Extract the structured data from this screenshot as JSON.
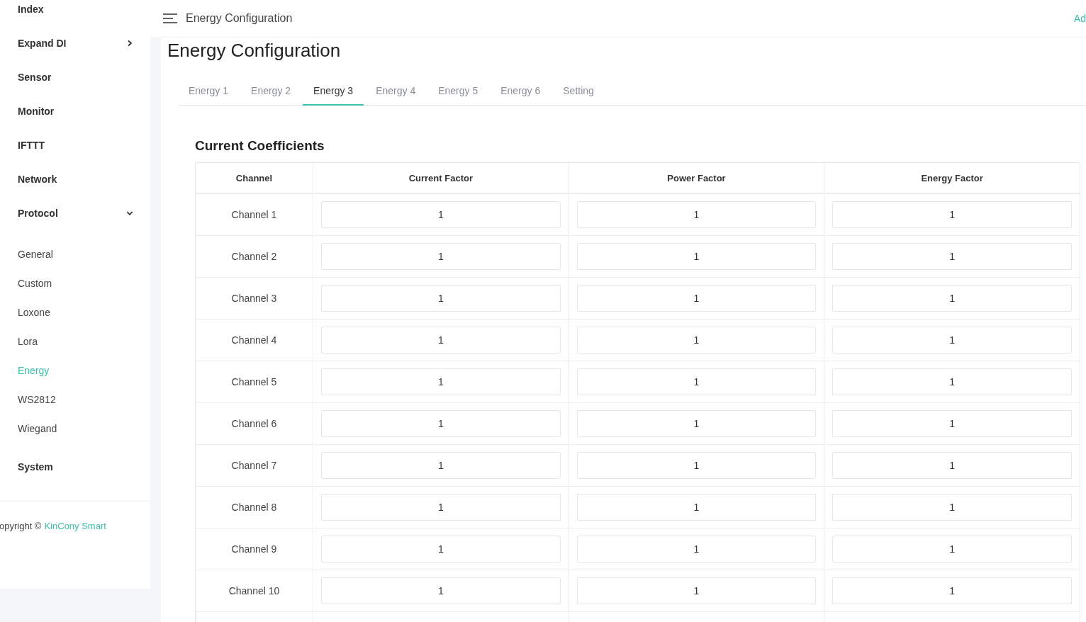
{
  "sidebar": {
    "items": [
      {
        "label": "Index",
        "kind": "group"
      },
      {
        "label": "Expand DI",
        "kind": "group",
        "expanded": false
      },
      {
        "label": "Sensor",
        "kind": "group"
      },
      {
        "label": "Monitor",
        "kind": "group"
      },
      {
        "label": "IFTTT",
        "kind": "group"
      },
      {
        "label": "Network",
        "kind": "group"
      },
      {
        "label": "Protocol",
        "kind": "group",
        "expanded": true,
        "children": [
          {
            "label": "General",
            "selected": false
          },
          {
            "label": "Custom",
            "selected": false
          },
          {
            "label": "Loxone",
            "selected": false
          },
          {
            "label": "Lora",
            "selected": false
          },
          {
            "label": "Energy",
            "selected": true
          },
          {
            "label": "WS2812",
            "selected": false
          },
          {
            "label": "Wiegand",
            "selected": false
          }
        ]
      },
      {
        "label": "System",
        "kind": "group"
      }
    ],
    "footer": {
      "text": "opyright ©",
      "link": "KinCony Smart"
    }
  },
  "header": {
    "title": "Energy Configuration",
    "user": "Ad"
  },
  "page": {
    "title": "Energy Configuration",
    "tabs": [
      {
        "label": "Energy 1",
        "selected": false
      },
      {
        "label": "Energy 2",
        "selected": false
      },
      {
        "label": "Energy 3",
        "selected": true
      },
      {
        "label": "Energy 4",
        "selected": false
      },
      {
        "label": "Energy 5",
        "selected": false
      },
      {
        "label": "Energy 6",
        "selected": false
      },
      {
        "label": "Setting",
        "selected": false
      }
    ],
    "section_title": "Current Coefficients",
    "table": {
      "columns": [
        "Channel",
        "Current Factor",
        "Power Factor",
        "Energy Factor"
      ],
      "rows": [
        {
          "channel": "Channel 1",
          "values": [
            "1",
            "1",
            "1"
          ]
        },
        {
          "channel": "Channel 2",
          "values": [
            "1",
            "1",
            "1"
          ]
        },
        {
          "channel": "Channel 3",
          "values": [
            "1",
            "1",
            "1"
          ]
        },
        {
          "channel": "Channel 4",
          "values": [
            "1",
            "1",
            "1"
          ]
        },
        {
          "channel": "Channel 5",
          "values": [
            "1",
            "1",
            "1"
          ]
        },
        {
          "channel": "Channel 6",
          "values": [
            "1",
            "1",
            "1"
          ]
        },
        {
          "channel": "Channel 7",
          "values": [
            "1",
            "1",
            "1"
          ]
        },
        {
          "channel": "Channel 8",
          "values": [
            "1",
            "1",
            "1"
          ]
        },
        {
          "channel": "Channel 9",
          "values": [
            "1",
            "1",
            "1"
          ]
        },
        {
          "channel": "Channel 10",
          "values": [
            "1",
            "1",
            "1"
          ]
        }
      ]
    }
  }
}
